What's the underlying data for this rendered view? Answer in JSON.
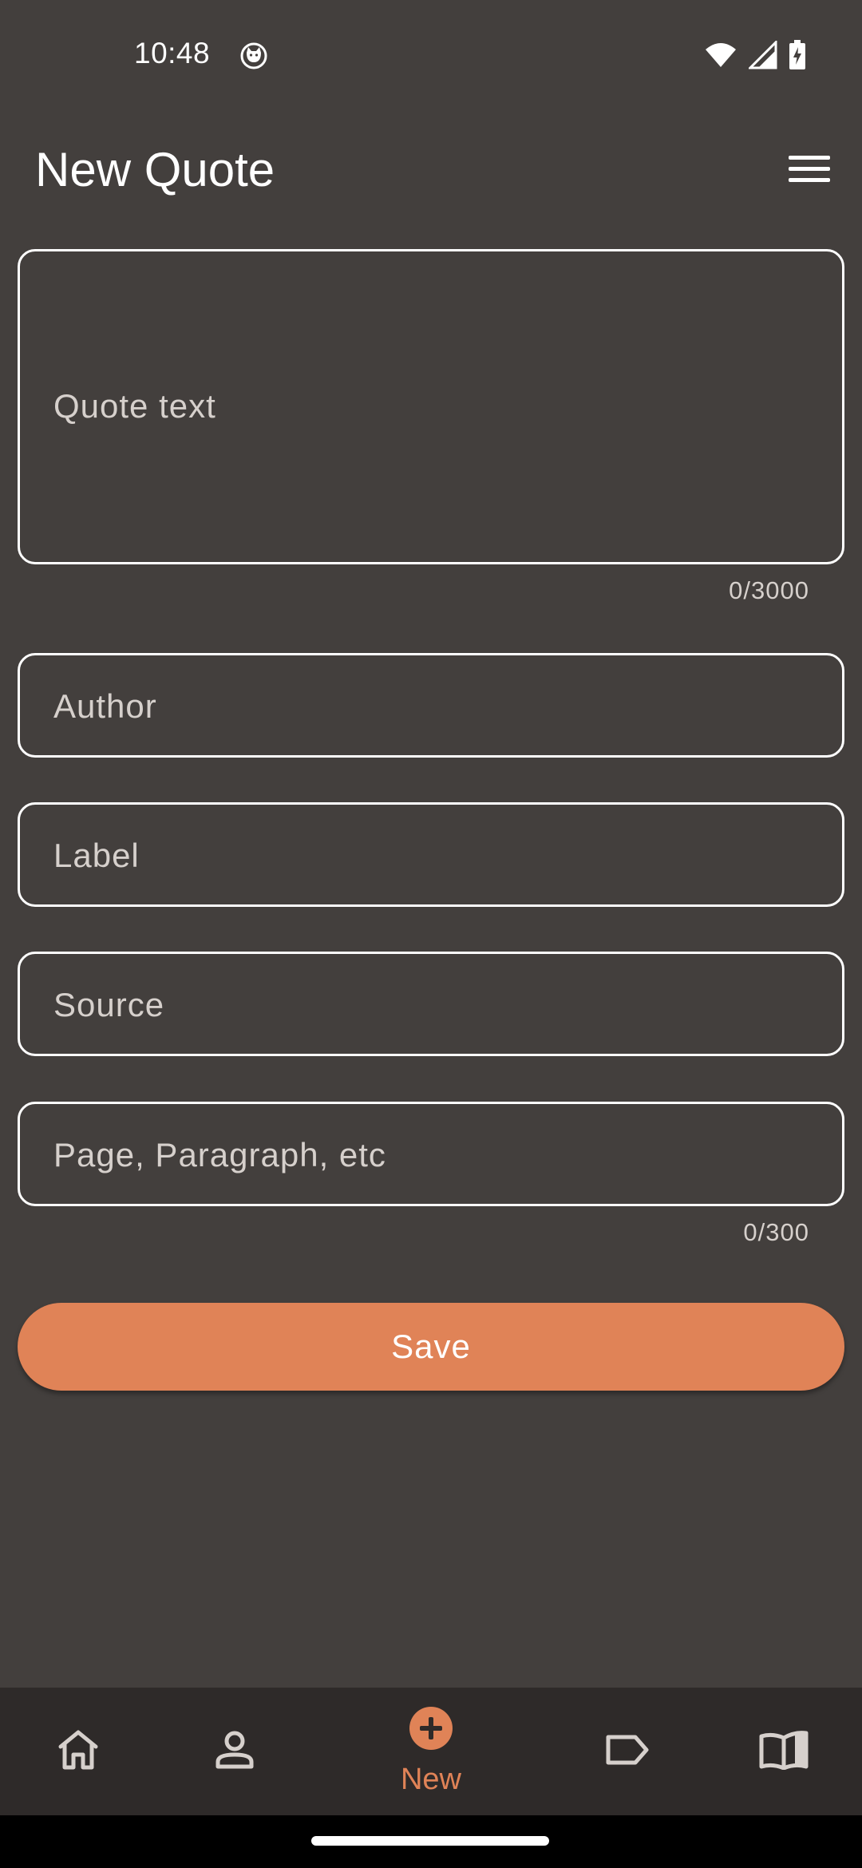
{
  "status_bar": {
    "time": "10:48",
    "icons": [
      "cat-notification-icon",
      "wifi-icon",
      "signal-icon",
      "battery-charging-icon"
    ]
  },
  "app_bar": {
    "title": "New Quote",
    "menu_icon": "hamburger-menu-icon"
  },
  "form": {
    "quote_text": {
      "placeholder": "Quote text",
      "value": "",
      "counter": "0/3000"
    },
    "author": {
      "placeholder": "Author",
      "value": ""
    },
    "label": {
      "placeholder": "Label",
      "value": ""
    },
    "source": {
      "placeholder": "Source",
      "value": ""
    },
    "page": {
      "placeholder": "Page, Paragraph, etc",
      "value": "",
      "counter": "0/300"
    },
    "save_label": "Save"
  },
  "bottom_nav": {
    "items": [
      {
        "icon": "home-icon",
        "label": ""
      },
      {
        "icon": "person-icon",
        "label": ""
      },
      {
        "icon": "add-circle-icon",
        "label": "New",
        "active": true
      },
      {
        "icon": "label-tag-icon",
        "label": ""
      },
      {
        "icon": "open-book-icon",
        "label": ""
      }
    ]
  },
  "colors": {
    "background": "#433f3d",
    "nav_background": "#2e2a29",
    "accent": "#e08357",
    "placeholder_text": "#d6d0cc"
  }
}
